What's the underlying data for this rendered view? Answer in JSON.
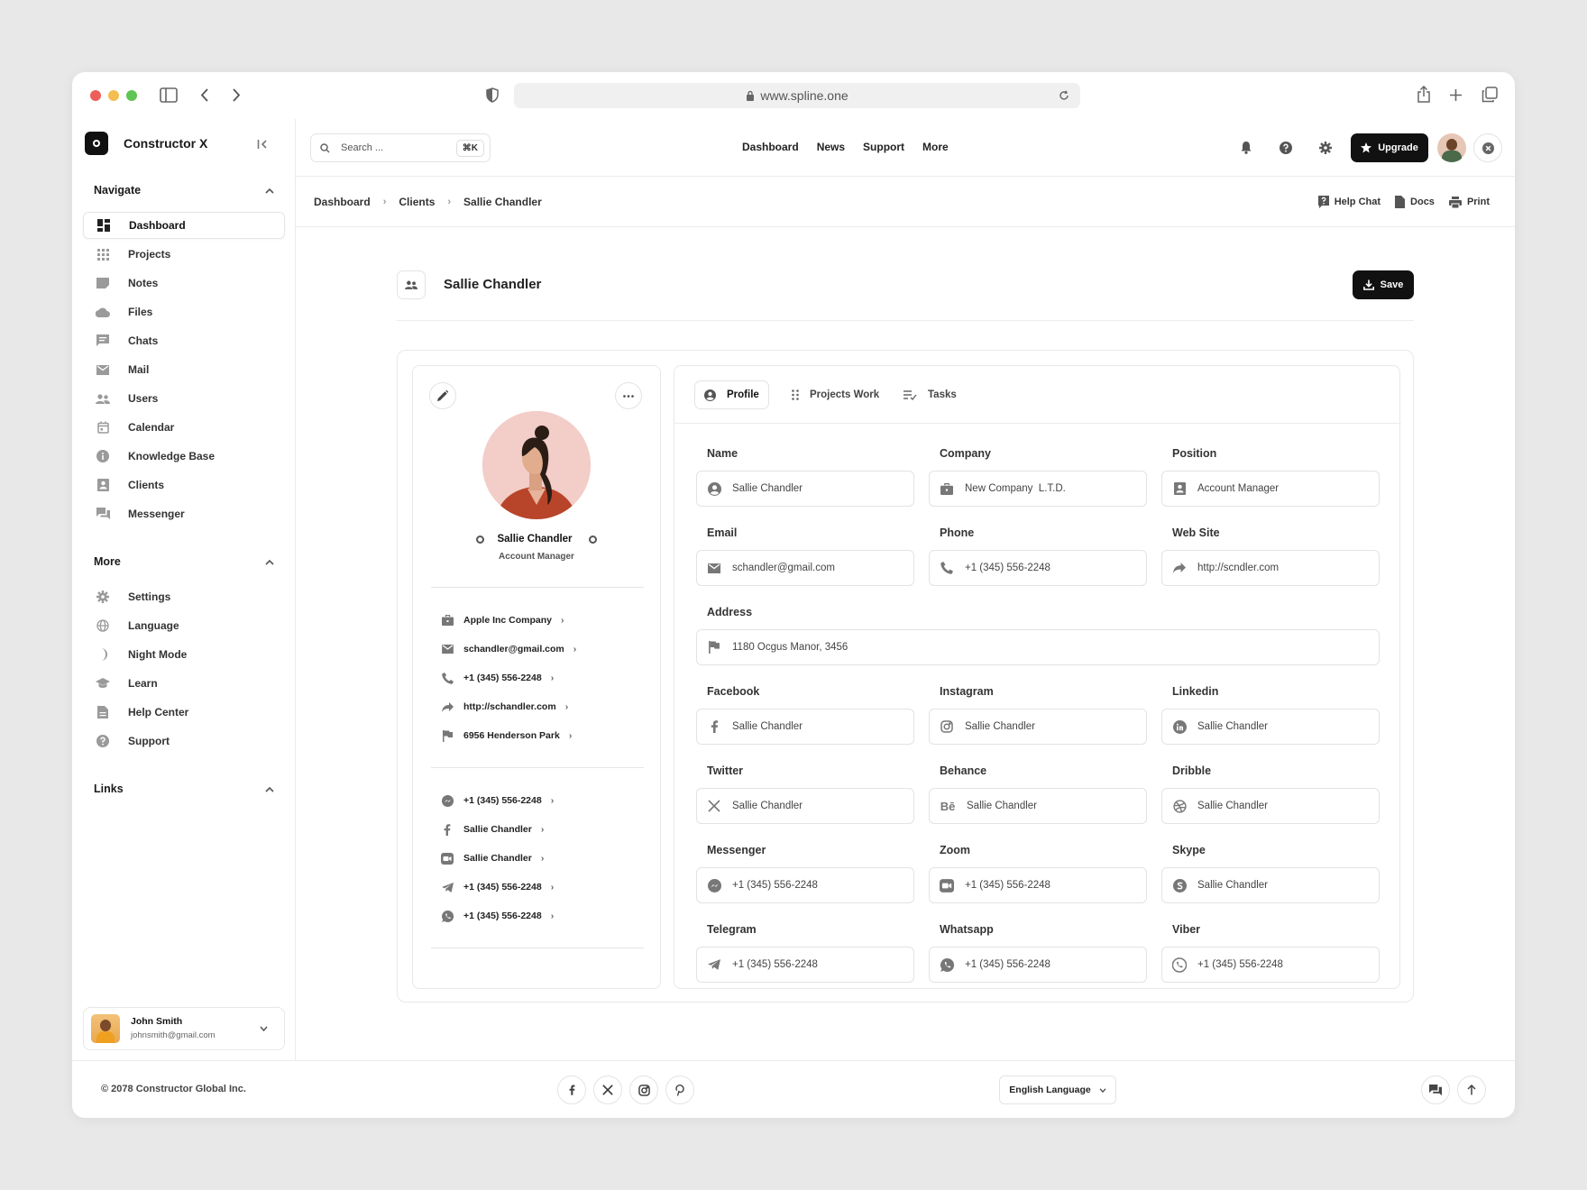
{
  "browser": {
    "url": "www.spline.one"
  },
  "sidebar": {
    "brand": "Constructor X",
    "navigate_title": "Navigate",
    "navigate_items": [
      {
        "label": "Dashboard",
        "icon": "dashboard-icon"
      },
      {
        "label": "Projects",
        "icon": "grid-icon"
      },
      {
        "label": "Notes",
        "icon": "note-icon"
      },
      {
        "label": "Files",
        "icon": "cloud-icon"
      },
      {
        "label": "Chats",
        "icon": "chat-icon"
      },
      {
        "label": "Mail",
        "icon": "mail-icon"
      },
      {
        "label": "Users",
        "icon": "users-icon"
      },
      {
        "label": "Calendar",
        "icon": "calendar-icon"
      },
      {
        "label": "Knowledge Base",
        "icon": "info-icon"
      },
      {
        "label": "Clients",
        "icon": "contact-icon"
      },
      {
        "label": "Messenger",
        "icon": "messenger-icon"
      }
    ],
    "more_title": "More",
    "more_items": [
      {
        "label": "Settings",
        "icon": "gear-icon"
      },
      {
        "label": "Language",
        "icon": "globe-icon"
      },
      {
        "label": "Night Mode",
        "icon": "moon-icon"
      },
      {
        "label": "Learn",
        "icon": "graduation-icon"
      },
      {
        "label": "Help Center",
        "icon": "document-icon"
      },
      {
        "label": "Support",
        "icon": "help-icon"
      }
    ],
    "links_title": "Links",
    "user": {
      "name": "John Smith",
      "email": "johnsmith@gmail.com"
    }
  },
  "topbar": {
    "search_placeholder": "Search ...",
    "search_shortcut": "⌘K",
    "nav": [
      "Dashboard",
      "News",
      "Support",
      "More"
    ],
    "upgrade_label": "Upgrade"
  },
  "breadcrumb": {
    "items": [
      "Dashboard",
      "Clients",
      "Sallie Chandler"
    ],
    "actions": [
      "Help Chat",
      "Docs",
      "Print"
    ]
  },
  "page": {
    "title": "Sallie Chandler",
    "save_label": "Save"
  },
  "profile_card": {
    "name": "Sallie Chandler",
    "role": "Account Manager",
    "info": [
      "Apple Inc Company",
      "schandler@gmail.com",
      "+1 (345) 556-2248",
      "http://schandler.com",
      "6956 Henderson Park"
    ],
    "contacts": [
      "+1 (345) 556-2248",
      "Sallie Chandler",
      "Sallie Chandler",
      "+1 (345) 556-2248",
      "+1 (345) 556-2248"
    ]
  },
  "tabs": [
    "Profile",
    "Projects Work",
    "Tasks"
  ],
  "form": {
    "name": {
      "label": "Name",
      "value": "Sallie Chandler"
    },
    "company": {
      "label": "Company",
      "value": "New Company  L.T.D."
    },
    "position": {
      "label": "Position",
      "value": "Account Manager"
    },
    "email": {
      "label": "Email",
      "value": "schandler@gmail.com"
    },
    "phone": {
      "label": "Phone",
      "value": "+1 (345) 556-2248"
    },
    "website": {
      "label": "Web Site",
      "value": "http://scndler.com"
    },
    "address": {
      "label": "Address",
      "value": "1180 Ocgus Manor, 3456"
    },
    "facebook": {
      "label": "Facebook",
      "value": "Sallie Chandler"
    },
    "instagram": {
      "label": "Instagram",
      "value": "Sallie Chandler"
    },
    "linkedin": {
      "label": "Linkedin",
      "value": "Sallie Chandler"
    },
    "twitter": {
      "label": "Twitter",
      "value": "Sallie Chandler"
    },
    "behance": {
      "label": "Behance",
      "value": "Sallie Chandler"
    },
    "dribble": {
      "label": "Dribble",
      "value": "Sallie Chandler"
    },
    "messenger": {
      "label": "Messenger",
      "value": "+1 (345) 556-2248"
    },
    "zoom": {
      "label": "Zoom",
      "value": "+1 (345) 556-2248"
    },
    "skype": {
      "label": "Skype",
      "value": "Sallie Chandler"
    },
    "telegram": {
      "label": "Telegram",
      "value": "+1 (345) 556-2248"
    },
    "whatsapp": {
      "label": "Whatsapp",
      "value": "+1 (345) 556-2248"
    },
    "viber": {
      "label": "Viber",
      "value": "+1 (345) 556-2248"
    }
  },
  "footer": {
    "copyright": "© 2078 Constructor Global Inc.",
    "language": "English Language"
  },
  "colors": {
    "accent": "#111111",
    "background": "#e8e8e8",
    "border": "#e3e3e3"
  }
}
